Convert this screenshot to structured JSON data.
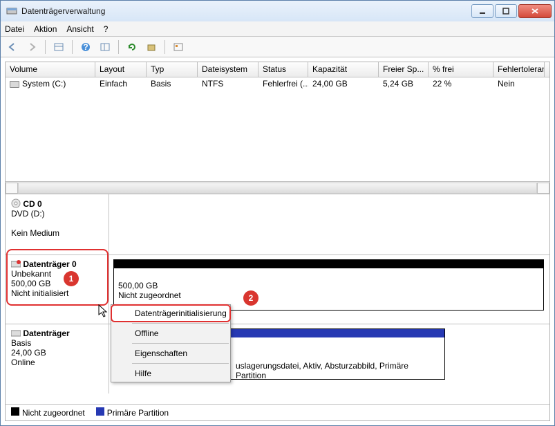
{
  "window": {
    "title": "Datenträgerverwaltung"
  },
  "menu": {
    "file": "Datei",
    "action": "Aktion",
    "view": "Ansicht",
    "help": "?"
  },
  "grid": {
    "headers": [
      "Volume",
      "Layout",
      "Typ",
      "Dateisystem",
      "Status",
      "Kapazität",
      "Freier Sp...",
      "% frei",
      "Fehlertoleranz"
    ],
    "row0": {
      "volume": "System (C:)",
      "layout": "Einfach",
      "typ": "Basis",
      "fs": "NTFS",
      "status": "Fehlerfrei (...",
      "cap": "24,00 GB",
      "free": "5,24 GB",
      "pct": "22 %",
      "fault": "Nein"
    }
  },
  "disks": {
    "cd": {
      "title": "CD 0",
      "sub": "DVD (D:)",
      "status": "Kein Medium"
    },
    "d0": {
      "title": "Datenträger 0",
      "line1": "Unbekannt",
      "line2": "500,00 GB",
      "line3": "Nicht initialisiert",
      "part_size": "500,00 GB",
      "part_state": "Nicht zugeordnet"
    },
    "d1": {
      "title": "Datenträger",
      "line1": "Basis",
      "line2": "24,00 GB",
      "line3": "Online",
      "part_tail": "uslagerungsdatei, Aktiv, Absturzabbild, Primäre Partition"
    }
  },
  "context": {
    "init": "Datenträgerinitialisierung",
    "offline": "Offline",
    "props": "Eigenschaften",
    "help": "Hilfe"
  },
  "legend": {
    "unalloc": "Nicht zugeordnet",
    "primary": "Primäre Partition"
  },
  "badges": {
    "one": "1",
    "two": "2"
  }
}
